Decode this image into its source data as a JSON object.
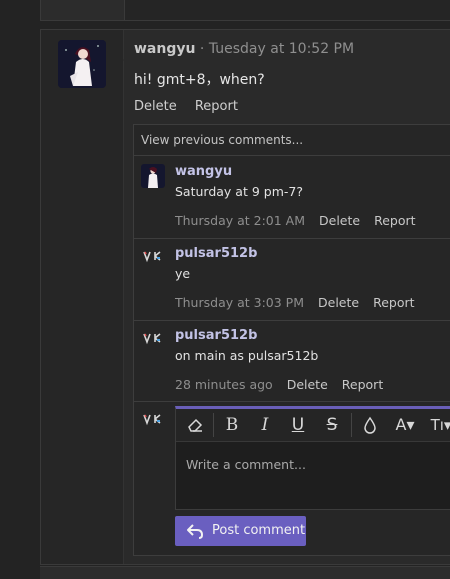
{
  "post": {
    "username": "wangyu",
    "separator": "·",
    "timestamp": "Tuesday at 10:52 PM",
    "body": "hi! gmt+8，when?",
    "actions": {
      "delete": "Delete",
      "report": "Report"
    }
  },
  "comments": {
    "view_previous": "View previous comments...",
    "items": [
      {
        "username": "wangyu",
        "text": "Saturday at 9 pm-7?",
        "time": "Thursday at 2:01 AM",
        "delete": "Delete",
        "report": "Report"
      },
      {
        "username": "pulsar512b",
        "text": "ye",
        "time": "Thursday at 3:03 PM",
        "delete": "Delete",
        "report": "Report"
      },
      {
        "username": "pulsar512b",
        "text": "on main as pulsar512b",
        "time": "28 minutes ago",
        "delete": "Delete",
        "report": "Report"
      }
    ]
  },
  "editor": {
    "placeholder": "Write a comment...",
    "toolbar": {
      "eraser": "⌫",
      "bold": "B",
      "italic": "I",
      "underline": "U",
      "strike": "S",
      "color": "◊",
      "font": "A▾",
      "size": "Tı▾"
    },
    "submit_label": "Post comment"
  },
  "colors": {
    "accent": "#6a5fc0",
    "username": "#c3c3e6"
  }
}
